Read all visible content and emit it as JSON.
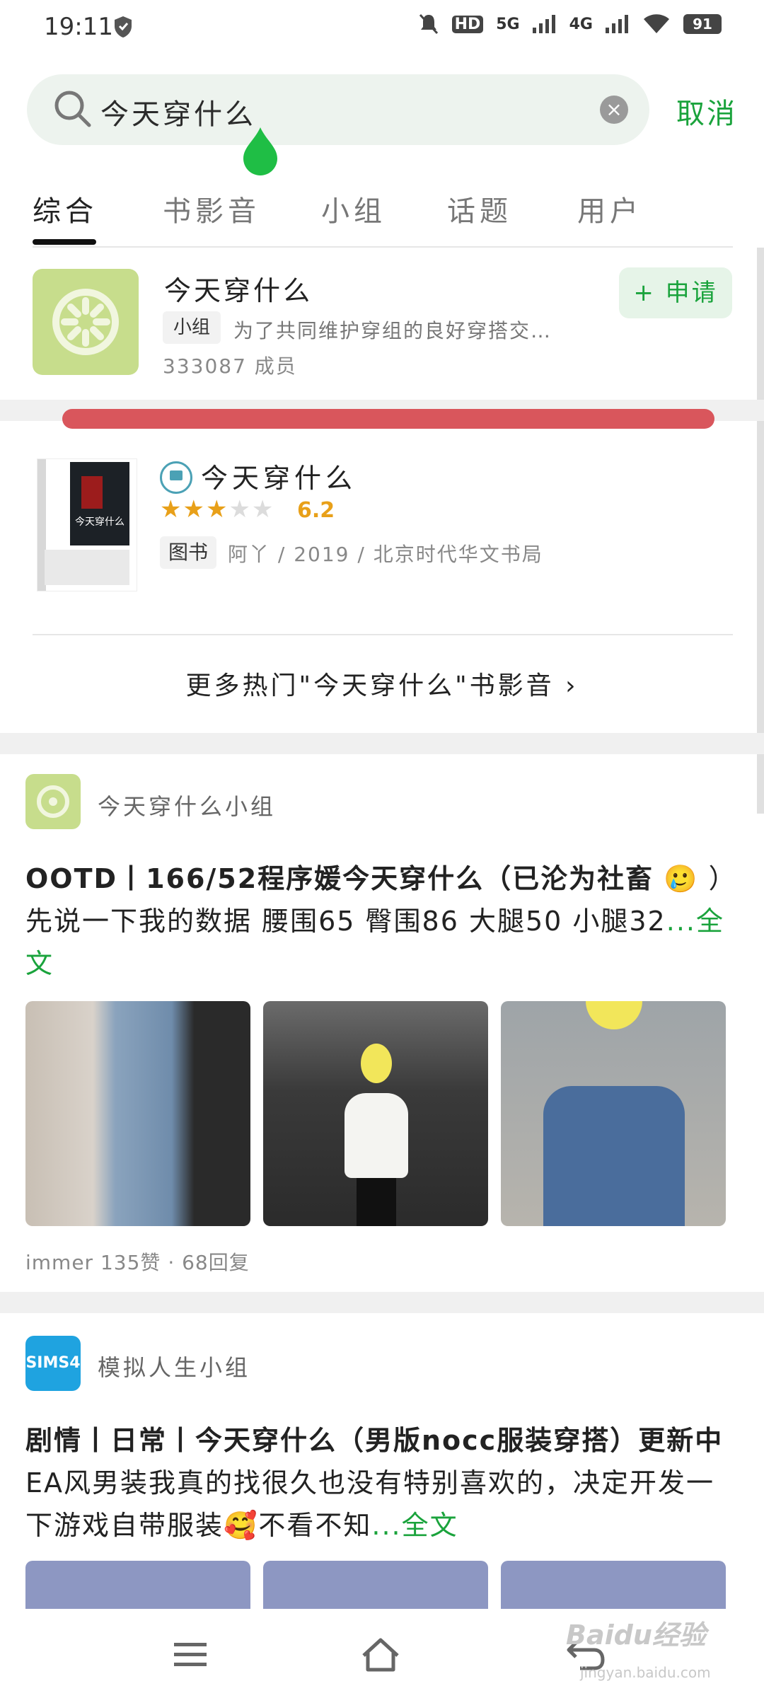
{
  "status_bar": {
    "time": "19:11",
    "network_labels": [
      "HD",
      "5G",
      "4G"
    ],
    "battery": "91"
  },
  "search": {
    "query": "今天穿什么",
    "cancel_label": "取消"
  },
  "tabs": [
    "综合",
    "书影音",
    "小组",
    "话题",
    "用户"
  ],
  "group_card": {
    "title": "今天穿什么",
    "tag": "小组",
    "description": "为了共同维护穿组的良好穿搭交…",
    "members": "333087 成员",
    "apply_label": "+ 申请"
  },
  "book": {
    "cover_title": "今天穿什么",
    "title": "今天穿什么",
    "stars": 3,
    "rating": "6.2",
    "tag": "图书",
    "meta": "阿丫 / 2019 / 北京时代华文书局"
  },
  "more_hot": "更多热门\"今天穿什么\"书影音 ›",
  "post1": {
    "group": "今天穿什么小组",
    "title": "OOTD丨166/52程序媛今天穿什么（已沦为社畜",
    "emoji": "🥲",
    "text": "）先说一下我的数据 腰围65 臀围86 大腿50 小腿32",
    "more": "...全文",
    "meta": "immer 135赞 · 68回复"
  },
  "post2": {
    "group": "模拟人生小组",
    "logo_text": "SIMS4",
    "title": "剧情丨日常丨今天穿什么（男版nocc服装穿搭）更新中",
    "text": " EA风男装我真的找很久也没有特别喜欢的，决定开发一下游戏自带服装",
    "emoji": "🥰",
    "text2": "不看不知",
    "more": "...全文"
  },
  "colors": {
    "accent_green": "#1aa33c",
    "group_logo": "#c7dd8c",
    "rating_orange": "#e8a019"
  },
  "watermark": {
    "brand": "Baidu经验",
    "url": "jingyan.baidu.com"
  }
}
